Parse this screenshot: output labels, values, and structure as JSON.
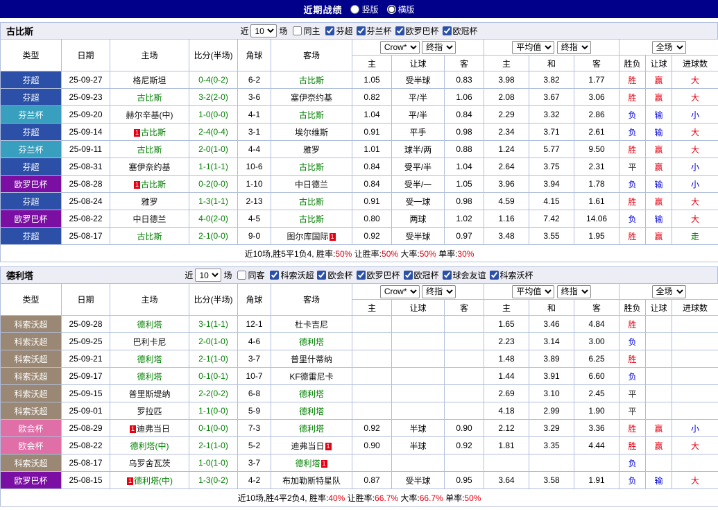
{
  "topbar": {
    "title": "近期战绩",
    "radios": [
      {
        "label": "竖版",
        "selected": false
      },
      {
        "label": "横版",
        "selected": true
      }
    ]
  },
  "type_colors": {
    "芬超": "#2c50a8",
    "芬兰杯": "#389fbe",
    "欧罗巴杯": "#7b0fa3",
    "科索沃超": "#9a8874",
    "欧会杯": "#e06fa8"
  },
  "text_colors": {
    "r": "#e60012",
    "b": "#0000d8",
    "g": "#008000",
    "k": "#333333"
  },
  "table_header": {
    "type": "类型",
    "date": "日期",
    "home": "主场",
    "score": "比分(半场)",
    "corner": "角球",
    "away": "客场",
    "sel_crow": "Crow*",
    "sel_final1": "终指",
    "sel_avg": "平均值",
    "sel_final2": "终指",
    "sel_full": "全场",
    "group1": [
      "主",
      "让球",
      "客"
    ],
    "group2": [
      "主",
      "和",
      "客"
    ],
    "group3": [
      "胜负",
      "让球",
      "进球数"
    ]
  },
  "sections": [
    {
      "team": "古比斯",
      "filter": {
        "near": "近",
        "count": "10",
        "games": "场",
        "same": "同主",
        "same_checked": false,
        "leagues": [
          {
            "label": "芬超",
            "checked": true
          },
          {
            "label": "芬兰杯",
            "checked": true
          },
          {
            "label": "欧罗巴杯",
            "checked": true
          },
          {
            "label": "欧冠杯",
            "checked": true
          }
        ]
      },
      "rows": [
        {
          "type": "芬超",
          "date": "25-09-27",
          "home": {
            "name": "格尼斯坦",
            "green": false,
            "card": ""
          },
          "score": "0-4(0-2)",
          "corner": "6-2",
          "away": {
            "name": "古比斯",
            "green": true,
            "card": ""
          },
          "crow": [
            "1.05",
            "受半球",
            "0.83"
          ],
          "avg": [
            "3.98",
            "3.82",
            "1.77"
          ],
          "full": [
            {
              "t": "胜",
              "c": "r"
            },
            {
              "t": "赢",
              "c": "r"
            },
            {
              "t": "大",
              "c": "r"
            }
          ]
        },
        {
          "type": "芬超",
          "date": "25-09-23",
          "home": {
            "name": "古比斯",
            "green": true,
            "card": ""
          },
          "score": "3-2(2-0)",
          "corner": "3-6",
          "away": {
            "name": "塞伊奈约基",
            "green": false,
            "card": ""
          },
          "crow": [
            "0.82",
            "平/半",
            "1.06"
          ],
          "avg": [
            "2.08",
            "3.67",
            "3.06"
          ],
          "full": [
            {
              "t": "胜",
              "c": "r"
            },
            {
              "t": "赢",
              "c": "r"
            },
            {
              "t": "大",
              "c": "r"
            }
          ]
        },
        {
          "type": "芬兰杯",
          "date": "25-09-20",
          "home": {
            "name": "赫尔辛基(中)",
            "green": false,
            "card": ""
          },
          "score": "1-0(0-0)",
          "corner": "4-1",
          "away": {
            "name": "古比斯",
            "green": true,
            "card": ""
          },
          "crow": [
            "1.04",
            "平/半",
            "0.84"
          ],
          "avg": [
            "2.29",
            "3.32",
            "2.86"
          ],
          "full": [
            {
              "t": "负",
              "c": "b"
            },
            {
              "t": "输",
              "c": "b"
            },
            {
              "t": "小",
              "c": "b"
            }
          ]
        },
        {
          "type": "芬超",
          "date": "25-09-14",
          "home": {
            "name": "古比斯",
            "green": true,
            "card": "before"
          },
          "score": "2-4(0-4)",
          "corner": "3-1",
          "away": {
            "name": "埃尔维斯",
            "green": false,
            "card": ""
          },
          "crow": [
            "0.91",
            "平手",
            "0.98"
          ],
          "avg": [
            "2.34",
            "3.71",
            "2.61"
          ],
          "full": [
            {
              "t": "负",
              "c": "b"
            },
            {
              "t": "输",
              "c": "b"
            },
            {
              "t": "大",
              "c": "r"
            }
          ]
        },
        {
          "type": "芬兰杯",
          "date": "25-09-11",
          "home": {
            "name": "古比斯",
            "green": true,
            "card": ""
          },
          "score": "2-0(1-0)",
          "corner": "4-4",
          "away": {
            "name": "雅罗",
            "green": false,
            "card": ""
          },
          "crow": [
            "1.01",
            "球半/两",
            "0.88"
          ],
          "avg": [
            "1.24",
            "5.77",
            "9.50"
          ],
          "full": [
            {
              "t": "胜",
              "c": "r"
            },
            {
              "t": "赢",
              "c": "r"
            },
            {
              "t": "大",
              "c": "r"
            }
          ]
        },
        {
          "type": "芬超",
          "date": "25-08-31",
          "home": {
            "name": "塞伊奈约基",
            "green": false,
            "card": ""
          },
          "score": "1-1(1-1)",
          "corner": "10-6",
          "away": {
            "name": "古比斯",
            "green": true,
            "card": ""
          },
          "crow": [
            "0.84",
            "受平/半",
            "1.04"
          ],
          "avg": [
            "2.64",
            "3.75",
            "2.31"
          ],
          "full": [
            {
              "t": "平",
              "c": "k"
            },
            {
              "t": "赢",
              "c": "r"
            },
            {
              "t": "小",
              "c": "b"
            }
          ]
        },
        {
          "type": "欧罗巴杯",
          "date": "25-08-28",
          "home": {
            "name": "古比斯",
            "green": true,
            "card": "before"
          },
          "score": "0-2(0-0)",
          "corner": "1-10",
          "away": {
            "name": "中日德兰",
            "green": false,
            "card": ""
          },
          "crow": [
            "0.84",
            "受半/一",
            "1.05"
          ],
          "avg": [
            "3.96",
            "3.94",
            "1.78"
          ],
          "full": [
            {
              "t": "负",
              "c": "b"
            },
            {
              "t": "输",
              "c": "b"
            },
            {
              "t": "小",
              "c": "b"
            }
          ]
        },
        {
          "type": "芬超",
          "date": "25-08-24",
          "home": {
            "name": "雅罗",
            "green": false,
            "card": ""
          },
          "score": "1-3(1-1)",
          "corner": "2-13",
          "away": {
            "name": "古比斯",
            "green": true,
            "card": ""
          },
          "crow": [
            "0.91",
            "受一球",
            "0.98"
          ],
          "avg": [
            "4.59",
            "4.15",
            "1.61"
          ],
          "full": [
            {
              "t": "胜",
              "c": "r"
            },
            {
              "t": "赢",
              "c": "r"
            },
            {
              "t": "大",
              "c": "r"
            }
          ]
        },
        {
          "type": "欧罗巴杯",
          "date": "25-08-22",
          "home": {
            "name": "中日德兰",
            "green": false,
            "card": ""
          },
          "score": "4-0(2-0)",
          "corner": "4-5",
          "away": {
            "name": "古比斯",
            "green": true,
            "card": ""
          },
          "crow": [
            "0.80",
            "两球",
            "1.02"
          ],
          "avg": [
            "1.16",
            "7.42",
            "14.06"
          ],
          "full": [
            {
              "t": "负",
              "c": "b"
            },
            {
              "t": "输",
              "c": "b"
            },
            {
              "t": "大",
              "c": "r"
            }
          ]
        },
        {
          "type": "芬超",
          "date": "25-08-17",
          "home": {
            "name": "古比斯",
            "green": true,
            "card": ""
          },
          "score": "2-1(0-0)",
          "corner": "9-0",
          "away": {
            "name": "图尔库国际",
            "green": false,
            "card": "after"
          },
          "crow": [
            "0.92",
            "受半球",
            "0.97"
          ],
          "avg": [
            "3.48",
            "3.55",
            "1.95"
          ],
          "full": [
            {
              "t": "胜",
              "c": "r"
            },
            {
              "t": "赢",
              "c": "r"
            },
            {
              "t": "走",
              "c": "g"
            }
          ]
        }
      ],
      "summary": {
        "prefix": "近10场,胜5平1负4,",
        "stats": [
          {
            "label": "胜率:",
            "value": "50%"
          },
          {
            "label": "让胜率:",
            "value": "50%"
          },
          {
            "label": "大率:",
            "value": "50%"
          },
          {
            "label": "单率:",
            "value": "30%"
          }
        ]
      }
    },
    {
      "team": "德利塔",
      "filter": {
        "near": "近",
        "count": "10",
        "games": "场",
        "same": "同客",
        "same_checked": false,
        "leagues": [
          {
            "label": "科索沃超",
            "checked": true
          },
          {
            "label": "欧会杯",
            "checked": true
          },
          {
            "label": "欧罗巴杯",
            "checked": true
          },
          {
            "label": "欧冠杯",
            "checked": true
          },
          {
            "label": "球会友谊",
            "checked": true
          },
          {
            "label": "科索沃杯",
            "checked": true
          }
        ]
      },
      "rows": [
        {
          "type": "科索沃超",
          "date": "25-09-28",
          "home": {
            "name": "德利塔",
            "green": true,
            "card": ""
          },
          "score": "3-1(1-1)",
          "corner": "12-1",
          "away": {
            "name": "杜卡吉尼",
            "green": false,
            "card": ""
          },
          "crow": [
            "",
            "",
            ""
          ],
          "avg": [
            "1.65",
            "3.46",
            "4.84"
          ],
          "full": [
            {
              "t": "胜",
              "c": "r"
            },
            {
              "t": "",
              "c": "k"
            },
            {
              "t": "",
              "c": "k"
            }
          ]
        },
        {
          "type": "科索沃超",
          "date": "25-09-25",
          "home": {
            "name": "巴利卡尼",
            "green": false,
            "card": ""
          },
          "score": "2-0(1-0)",
          "corner": "4-6",
          "away": {
            "name": "德利塔",
            "green": true,
            "card": ""
          },
          "crow": [
            "",
            "",
            ""
          ],
          "avg": [
            "2.23",
            "3.14",
            "3.00"
          ],
          "full": [
            {
              "t": "负",
              "c": "b"
            },
            {
              "t": "",
              "c": "k"
            },
            {
              "t": "",
              "c": "k"
            }
          ]
        },
        {
          "type": "科索沃超",
          "date": "25-09-21",
          "home": {
            "name": "德利塔",
            "green": true,
            "card": ""
          },
          "score": "2-1(1-0)",
          "corner": "3-7",
          "away": {
            "name": "普里什蒂纳",
            "green": false,
            "card": ""
          },
          "crow": [
            "",
            "",
            ""
          ],
          "avg": [
            "1.48",
            "3.89",
            "6.25"
          ],
          "full": [
            {
              "t": "胜",
              "c": "r"
            },
            {
              "t": "",
              "c": "k"
            },
            {
              "t": "",
              "c": "k"
            }
          ]
        },
        {
          "type": "科索沃超",
          "date": "25-09-17",
          "home": {
            "name": "德利塔",
            "green": true,
            "card": ""
          },
          "score": "0-1(0-1)",
          "corner": "10-7",
          "away": {
            "name": "KF德雷尼卡",
            "green": false,
            "card": ""
          },
          "crow": [
            "",
            "",
            ""
          ],
          "avg": [
            "1.44",
            "3.91",
            "6.60"
          ],
          "full": [
            {
              "t": "负",
              "c": "b"
            },
            {
              "t": "",
              "c": "k"
            },
            {
              "t": "",
              "c": "k"
            }
          ]
        },
        {
          "type": "科索沃超",
          "date": "25-09-15",
          "home": {
            "name": "普里斯堤纳",
            "green": false,
            "card": ""
          },
          "score": "2-2(0-2)",
          "corner": "6-8",
          "away": {
            "name": "德利塔",
            "green": true,
            "card": ""
          },
          "crow": [
            "",
            "",
            ""
          ],
          "avg": [
            "2.69",
            "3.10",
            "2.45"
          ],
          "full": [
            {
              "t": "平",
              "c": "k"
            },
            {
              "t": "",
              "c": "k"
            },
            {
              "t": "",
              "c": "k"
            }
          ]
        },
        {
          "type": "科索沃超",
          "date": "25-09-01",
          "home": {
            "name": "罗拉匹",
            "green": false,
            "card": ""
          },
          "score": "1-1(0-0)",
          "corner": "5-9",
          "away": {
            "name": "德利塔",
            "green": true,
            "card": ""
          },
          "crow": [
            "",
            "",
            ""
          ],
          "avg": [
            "4.18",
            "2.99",
            "1.90"
          ],
          "full": [
            {
              "t": "平",
              "c": "k"
            },
            {
              "t": "",
              "c": "k"
            },
            {
              "t": "",
              "c": "k"
            }
          ]
        },
        {
          "type": "欧会杯",
          "date": "25-08-29",
          "home": {
            "name": "迪弗当日",
            "green": false,
            "card": "before"
          },
          "score": "0-1(0-0)",
          "corner": "7-3",
          "away": {
            "name": "德利塔",
            "green": true,
            "card": ""
          },
          "crow": [
            "0.92",
            "半球",
            "0.90"
          ],
          "avg": [
            "2.12",
            "3.29",
            "3.36"
          ],
          "full": [
            {
              "t": "胜",
              "c": "r"
            },
            {
              "t": "赢",
              "c": "r"
            },
            {
              "t": "小",
              "c": "b"
            }
          ]
        },
        {
          "type": "欧会杯",
          "date": "25-08-22",
          "home": {
            "name": "德利塔(中)",
            "green": true,
            "card": ""
          },
          "score": "2-1(1-0)",
          "corner": "5-2",
          "away": {
            "name": "迪弗当日",
            "green": false,
            "card": "after"
          },
          "crow": [
            "0.90",
            "半球",
            "0.92"
          ],
          "avg": [
            "1.81",
            "3.35",
            "4.44"
          ],
          "full": [
            {
              "t": "胜",
              "c": "r"
            },
            {
              "t": "赢",
              "c": "r"
            },
            {
              "t": "大",
              "c": "r"
            }
          ]
        },
        {
          "type": "科索沃超",
          "date": "25-08-17",
          "home": {
            "name": "乌罗舍瓦茨",
            "green": false,
            "card": ""
          },
          "score": "1-0(1-0)",
          "corner": "3-7",
          "away": {
            "name": "德利塔",
            "green": true,
            "card": "after"
          },
          "crow": [
            "",
            "",
            ""
          ],
          "avg": [
            "",
            "",
            ""
          ],
          "full": [
            {
              "t": "负",
              "c": "b"
            },
            {
              "t": "",
              "c": "k"
            },
            {
              "t": "",
              "c": "k"
            }
          ]
        },
        {
          "type": "欧罗巴杯",
          "date": "25-08-15",
          "home": {
            "name": "德利塔(中)",
            "green": true,
            "card": "before"
          },
          "score": "1-3(0-2)",
          "corner": "4-2",
          "away": {
            "name": "布加勒斯特星队",
            "green": false,
            "card": ""
          },
          "crow": [
            "0.87",
            "受半球",
            "0.95"
          ],
          "avg": [
            "3.64",
            "3.58",
            "1.91"
          ],
          "full": [
            {
              "t": "负",
              "c": "b"
            },
            {
              "t": "输",
              "c": "b"
            },
            {
              "t": "大",
              "c": "r"
            }
          ]
        }
      ],
      "summary": {
        "prefix": "近10场,胜4平2负4,",
        "stats": [
          {
            "label": "胜率:",
            "value": "40%"
          },
          {
            "label": "让胜率:",
            "value": "66.7%"
          },
          {
            "label": "大率:",
            "value": "66.7%"
          },
          {
            "label": "单率:",
            "value": "50%"
          }
        ]
      }
    }
  ]
}
